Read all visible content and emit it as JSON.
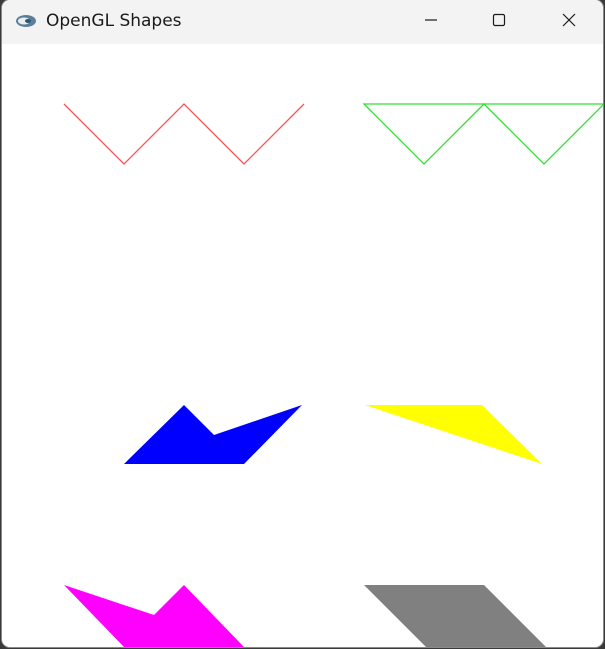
{
  "window": {
    "title": "OpenGL Shapes",
    "app_icon": "opengl-app-icon",
    "controls": [
      {
        "name": "minimize-button",
        "icon": "minimize-icon"
      },
      {
        "name": "maximize-button",
        "icon": "maximize-icon"
      },
      {
        "name": "close-button",
        "icon": "close-icon"
      }
    ]
  },
  "canvas": {
    "background": "#ffffff",
    "shapes": [
      {
        "name": "red-line-strip",
        "mode": "line-strip",
        "color": "#ff5050"
      },
      {
        "name": "green-triangle-outlines",
        "mode": "line-loop",
        "color": "#33e033"
      },
      {
        "name": "blue-polygon",
        "mode": "filled-polygon",
        "color": "#0000ff"
      },
      {
        "name": "yellow-triangle",
        "mode": "filled-triangle",
        "color": "#ffff00"
      },
      {
        "name": "magenta-polygon",
        "mode": "filled-polygon",
        "color": "#ff00ff"
      },
      {
        "name": "gray-parallelogram",
        "mode": "filled-quad",
        "color": "#808080"
      }
    ]
  }
}
